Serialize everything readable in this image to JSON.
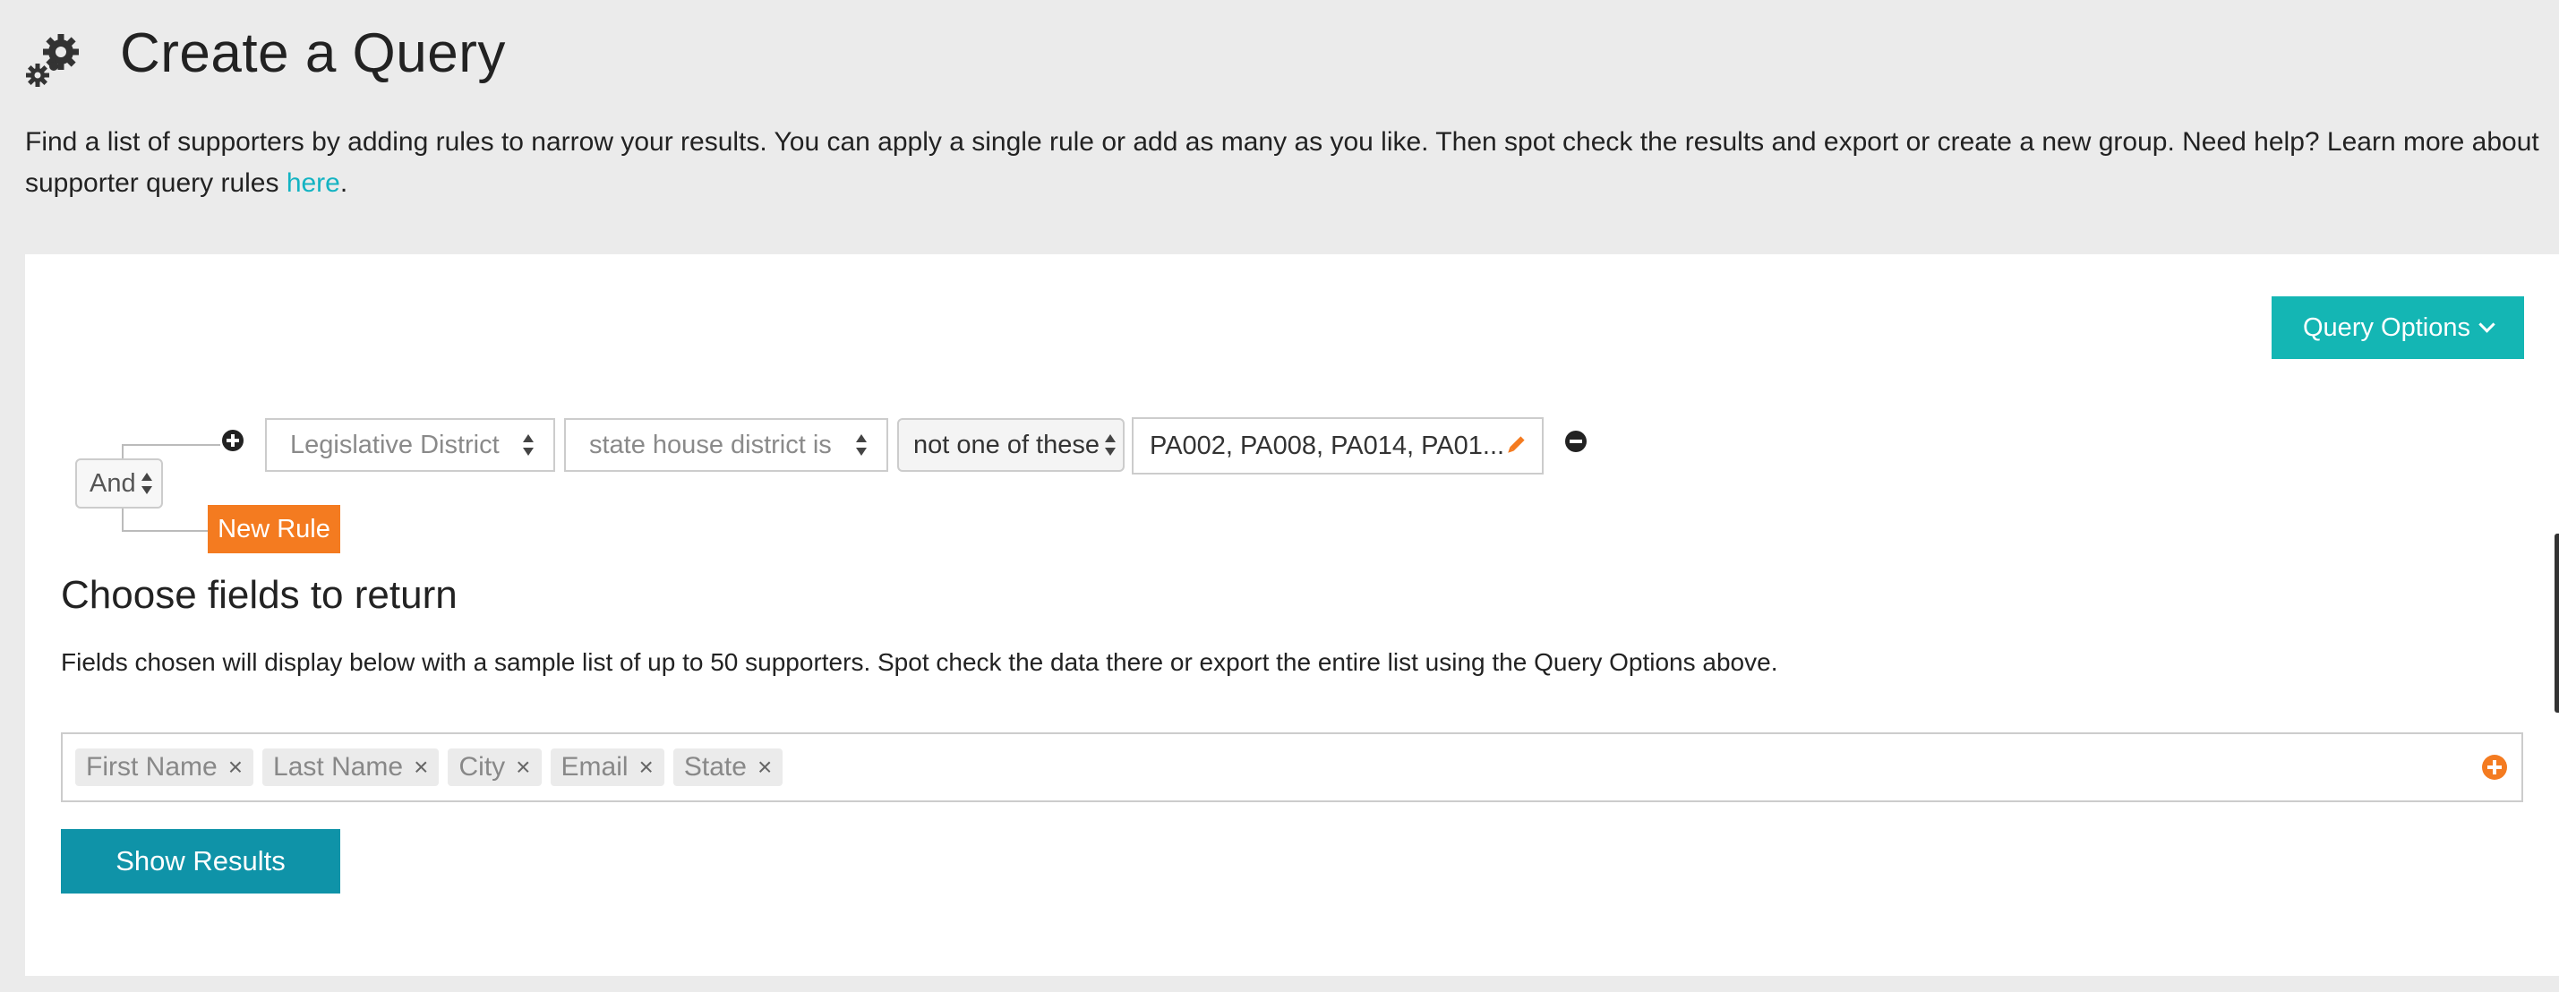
{
  "header": {
    "title": "Create a Query",
    "icon": "gears-icon"
  },
  "intro": {
    "text": "Find a list of supporters by adding rules to narrow your results. You can apply a single rule or add as many as you like. Then spot check the results and export or create a new group. Need help? Learn more about supporter query rules ",
    "link_text": "here",
    "end": "."
  },
  "query_options": {
    "label": "Query Options"
  },
  "rule_group": {
    "operator": "And",
    "new_rule_label": "New Rule",
    "rules": [
      {
        "field": "Legislative District",
        "condition": "state house district is",
        "match": "not one of these",
        "value": "PA002, PA008, PA014, PA01..."
      }
    ]
  },
  "fields_section": {
    "title": "Choose fields to return",
    "description": "Fields chosen will display below with a sample list of up to 50 supporters. Spot check the data there or export the entire list using the Query Options above.",
    "tags": [
      "First Name",
      "Last Name",
      "City",
      "Email",
      "State"
    ],
    "remove_glyph": "×"
  },
  "show_results": {
    "label": "Show Results"
  },
  "colors": {
    "teal": "#14b6b4",
    "dark_teal": "#0f93a8",
    "orange": "#f47b20",
    "link": "#13b3c2",
    "background": "#ebebeb"
  }
}
